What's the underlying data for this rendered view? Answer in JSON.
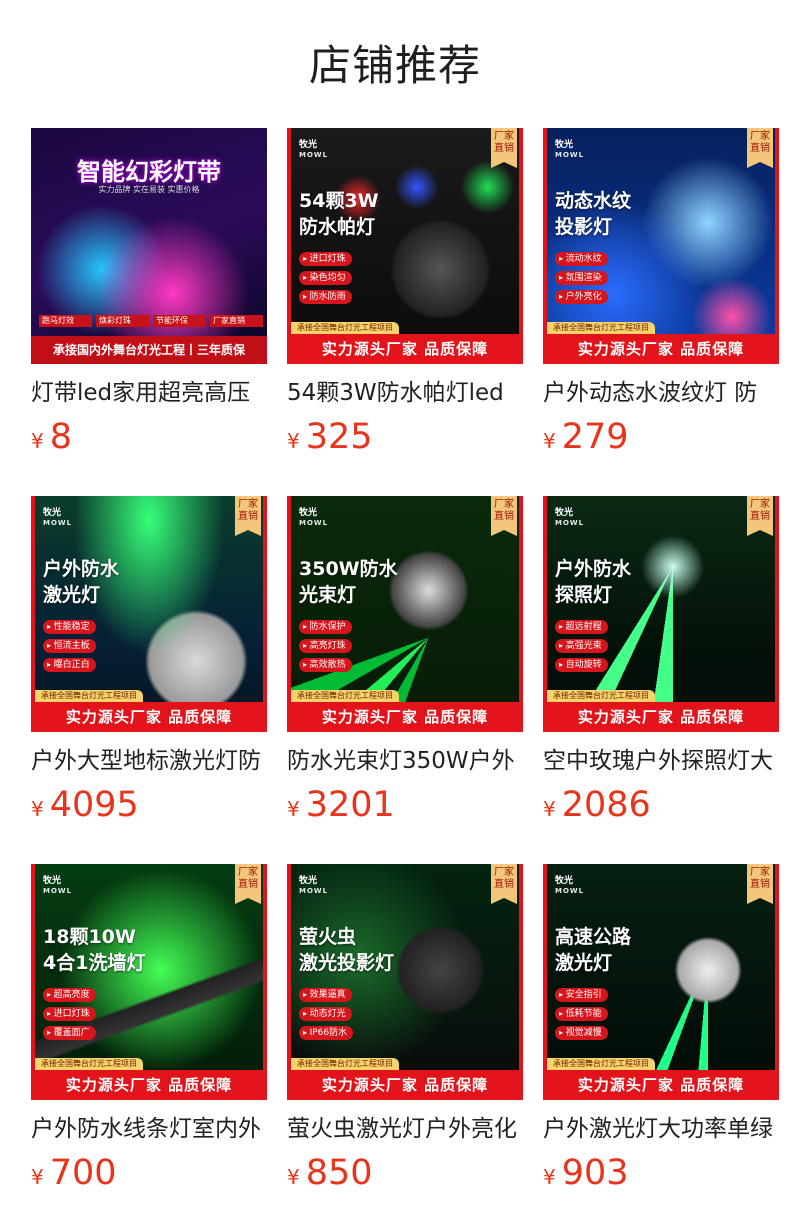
{
  "page_title": "店铺推荐",
  "currency_symbol": "¥",
  "common": {
    "brand_cn": "牧光",
    "brand_en": "MOWL",
    "factory_tag": "厂家直销",
    "project_strip": "承接全国舞台灯光工程项目",
    "banner": "实力源头厂家 品质保障"
  },
  "products": [
    {
      "name": "灯带led家用超亮高压",
      "price": "8",
      "thumb": {
        "headline": "智能幻彩灯带",
        "sub": "实力品牌 实在易装 实惠价格",
        "features": [
          "跑马灯效",
          "焕彩灯珠",
          "节能环保",
          "厂家直销"
        ],
        "banner": "承接国内外舞台灯光工程丨三年质保"
      }
    },
    {
      "name": "54颗3W防水帕灯led",
      "price": "325",
      "thumb": {
        "headline": "54颗3W\n防水帕灯",
        "features": [
          "进口灯珠",
          "染色均匀",
          "防水防雨"
        ]
      }
    },
    {
      "name": "户外动态水波纹灯 防",
      "price": "279",
      "thumb": {
        "headline": "动态水纹\n投影灯",
        "features": [
          "流动水纹",
          "氛围渲染",
          "户外亮化"
        ]
      }
    },
    {
      "name": "户外大型地标激光灯防",
      "price": "4095",
      "thumb": {
        "headline": "户外防水\n激光灯",
        "features": [
          "性能稳定",
          "恒流主板",
          "曝白正白"
        ]
      }
    },
    {
      "name": "防水光束灯350W户外",
      "price": "3201",
      "thumb": {
        "headline": "350W防水\n光束灯",
        "features": [
          "防水保护",
          "高亮灯珠",
          "高效散热"
        ]
      }
    },
    {
      "name": "空中玫瑰户外探照灯大",
      "price": "2086",
      "thumb": {
        "headline": "户外防水\n探照灯",
        "features": [
          "超远射程",
          "高强光束",
          "自动旋转"
        ]
      }
    },
    {
      "name": "户外防水线条灯室内外",
      "price": "700",
      "thumb": {
        "headline": "18颗10W\n4合1洗墙灯",
        "features": [
          "超高亮度",
          "进口灯珠",
          "覆盖面广"
        ]
      }
    },
    {
      "name": "萤火虫激光灯户外亮化",
      "price": "850",
      "thumb": {
        "headline": "萤火虫\n激光投影灯",
        "features": [
          "效果逼真",
          "动态灯光",
          "IP66防水"
        ]
      }
    },
    {
      "name": "户外激光灯大功率单绿",
      "price": "903",
      "thumb": {
        "headline": "高速公路\n激光灯",
        "features": [
          "安全指引",
          "低耗节能",
          "视觉减慢"
        ]
      }
    }
  ],
  "colors": {
    "price": "#e8341c",
    "banner_red": "#e3131b",
    "title_text": "#1e1e1e"
  }
}
